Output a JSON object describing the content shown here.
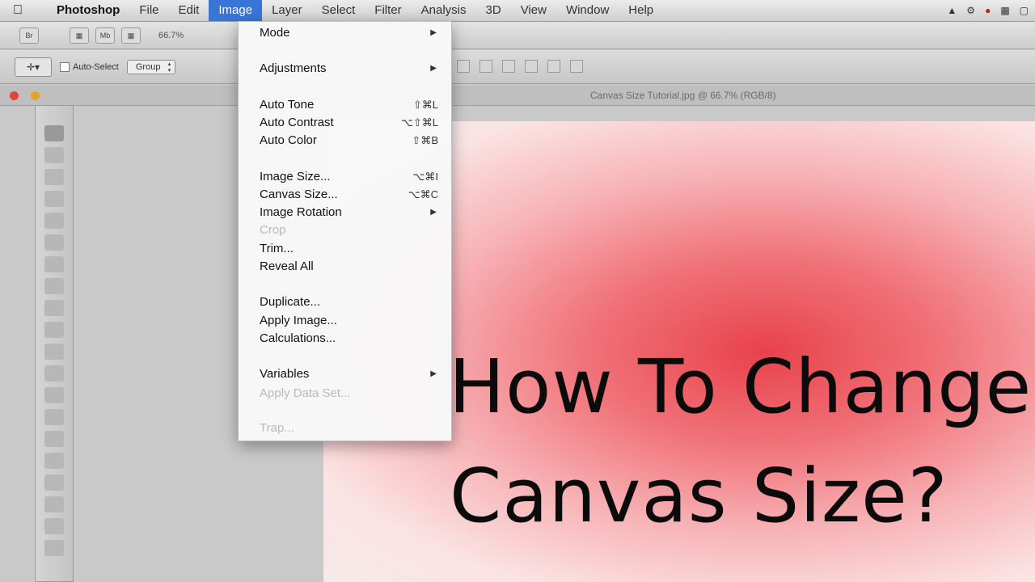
{
  "menubar": {
    "app_name": "Photoshop",
    "items": [
      "File",
      "Edit",
      "Image",
      "Layer",
      "Select",
      "Filter",
      "Analysis",
      "3D",
      "View",
      "Window",
      "Help"
    ],
    "active_item": "Image"
  },
  "appbar": {
    "zoom": "66.7%"
  },
  "options": {
    "auto_select_label": "Auto-Select",
    "group_select_value": "Group"
  },
  "document": {
    "title": "Canvas Size Tutorial.jpg @ 66.7% (RGB/8)"
  },
  "image_menu": {
    "mode": "Mode",
    "adjustments": "Adjustments",
    "auto_tone": "Auto Tone",
    "auto_tone_sc": "⇧⌘L",
    "auto_contrast": "Auto Contrast",
    "auto_contrast_sc": "⌥⇧⌘L",
    "auto_color": "Auto Color",
    "auto_color_sc": "⇧⌘B",
    "image_size": "Image Size...",
    "image_size_sc": "⌥⌘I",
    "canvas_size": "Canvas Size...",
    "canvas_size_sc": "⌥⌘C",
    "image_rotation": "Image Rotation",
    "crop": "Crop",
    "trim": "Trim...",
    "reveal_all": "Reveal All",
    "duplicate": "Duplicate...",
    "apply_image": "Apply Image...",
    "calculations": "Calculations...",
    "variables": "Variables",
    "apply_data_set": "Apply Data Set...",
    "trap": "Trap..."
  },
  "canvas": {
    "headline_line1": "How To Change",
    "headline_line2": "Canvas Size?"
  },
  "colors": {
    "menu_highlight": "#3875d7",
    "canvas_red": "#e8424b"
  }
}
